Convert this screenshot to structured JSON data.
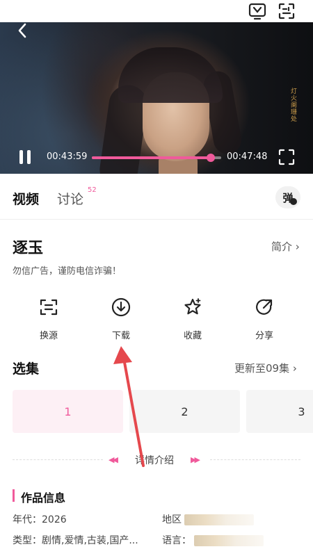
{
  "player": {
    "current_time": "00:43:59",
    "duration": "00:47:48",
    "progress_fraction": 0.92,
    "overlay_text": "灯火阑珊处",
    "accent": "#f05a9b"
  },
  "tabs": {
    "video": "视频",
    "discuss": "讨论",
    "discuss_count": "52",
    "danmu": "弹"
  },
  "show": {
    "title": "逐玉",
    "intro_link": "简介 ›",
    "notice": "勿信广告，谨防电信诈骗！"
  },
  "actions": [
    {
      "label": "换源",
      "icon": "switch-source-icon"
    },
    {
      "label": "下载",
      "icon": "download-icon"
    },
    {
      "label": "收藏",
      "icon": "star-icon"
    },
    {
      "label": "分享",
      "icon": "share-icon"
    }
  ],
  "episodes": {
    "title": "选集",
    "update": "更新至09集 ›",
    "items": [
      "1",
      "2",
      "3"
    ]
  },
  "detail": {
    "label": "详情介绍"
  },
  "info": {
    "title": "作品信息",
    "year": "年代：2026",
    "region_label": "地区",
    "type": "类型：剧情,爱情,古装,国产...",
    "lang_label": "语言："
  }
}
